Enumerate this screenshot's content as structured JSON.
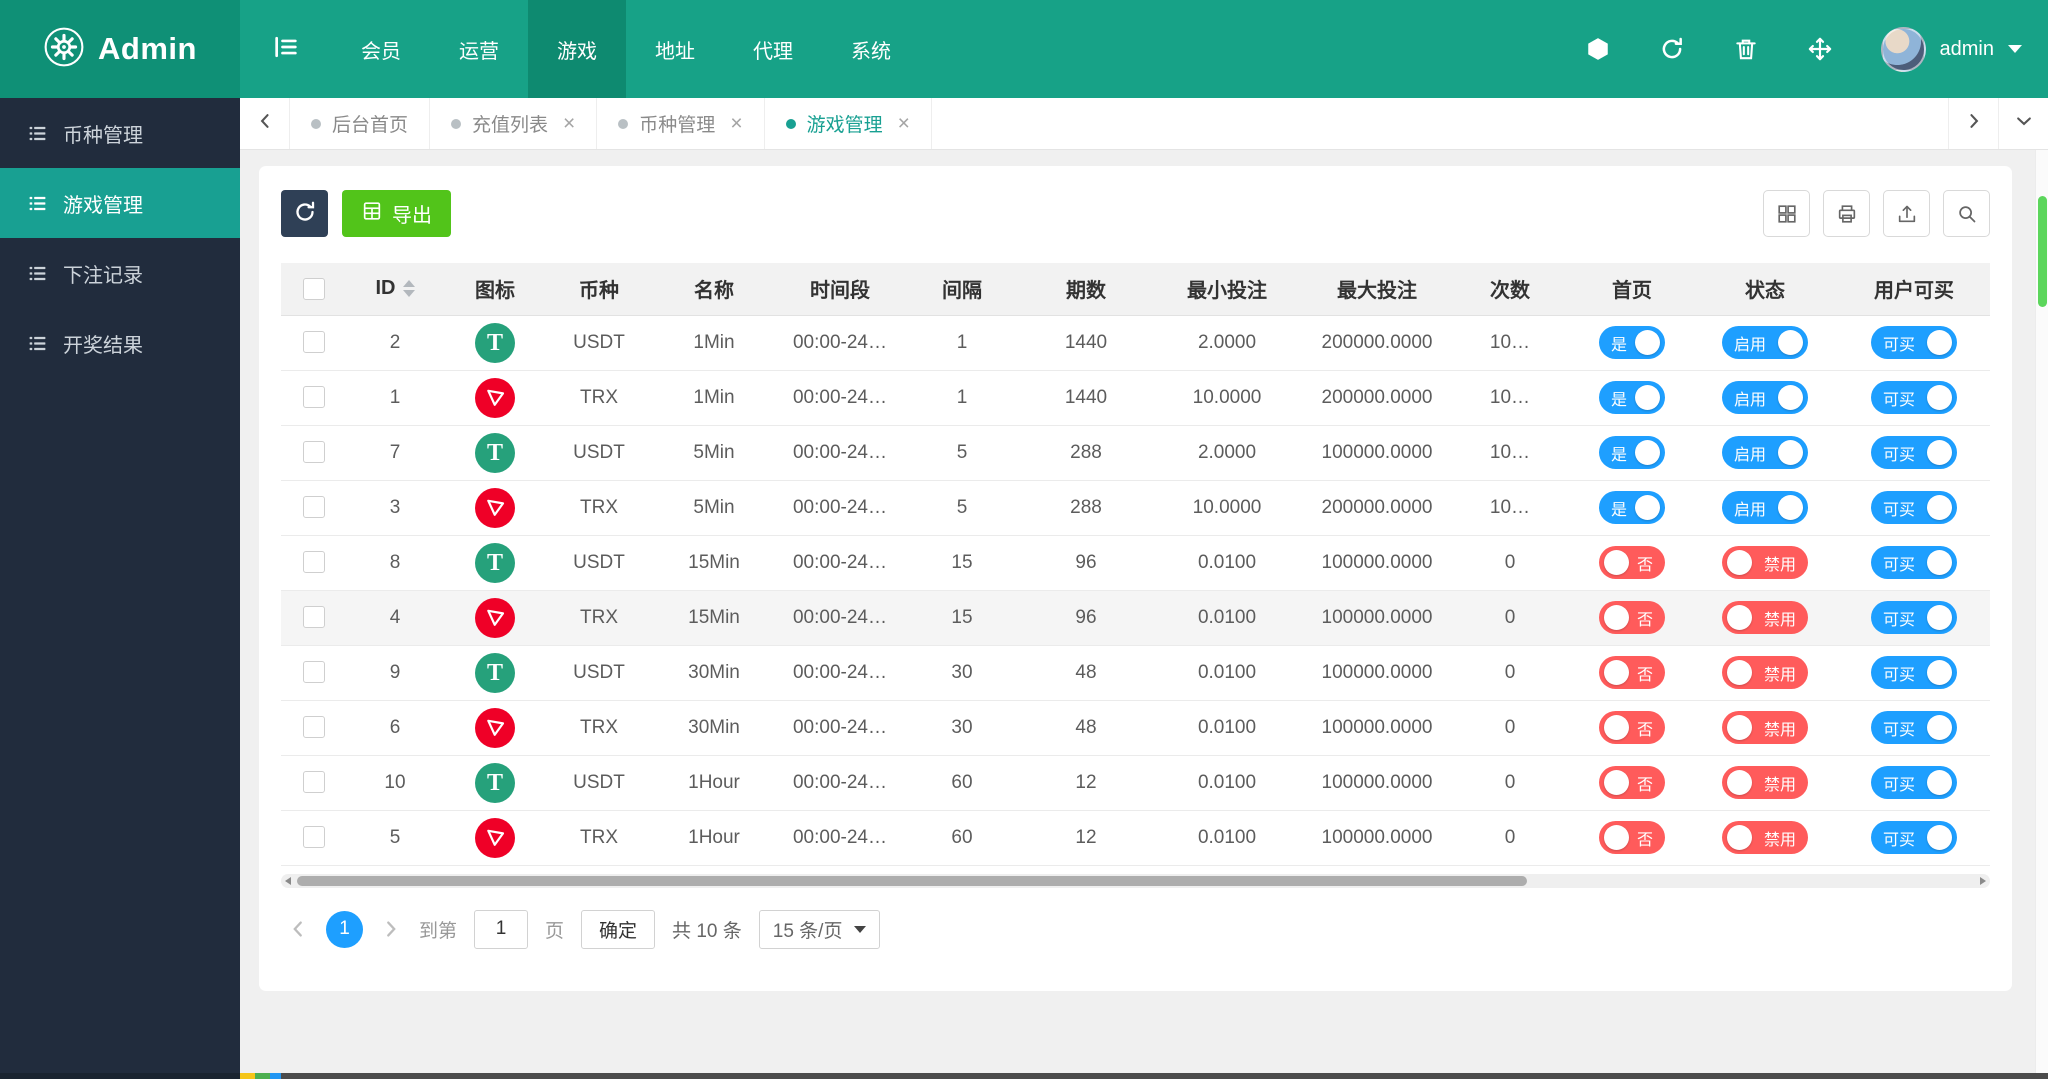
{
  "colors": {
    "header_teal": "#17A287",
    "logo_teal": "#0F9076",
    "active_menu_teal": "#0E8A70",
    "sidebar_bg": "#212C3D",
    "accent_teal": "#18A092",
    "toggle_on_blue": "#1E9FFF",
    "toggle_off_red": "#FF5B5B",
    "export_green": "#52C41A",
    "dark_button": "#2F4056",
    "usdt_green": "#26A17B",
    "trx_red": "#EF0027",
    "page_active_blue": "#1E9FFF",
    "vscroll_thumb_green": "#5CD65C"
  },
  "header": {
    "brand": "Admin",
    "logo_icon": "gear-icon",
    "collapse_icon": "collapse-sidebar-icon",
    "menu": [
      {
        "label": "会员",
        "active": false
      },
      {
        "label": "运营",
        "active": false
      },
      {
        "label": "游戏",
        "active": true
      },
      {
        "label": "地址",
        "active": false
      },
      {
        "label": "代理",
        "active": false
      },
      {
        "label": "系统",
        "active": false
      }
    ],
    "action_icons": [
      "cube-icon",
      "refresh-icon",
      "trash-icon",
      "move-arrows-icon"
    ],
    "user": {
      "name": "admin"
    }
  },
  "sidebar": {
    "items": [
      {
        "label": "币种管理",
        "active": false
      },
      {
        "label": "游戏管理",
        "active": true
      },
      {
        "label": "下注记录",
        "active": false
      },
      {
        "label": "开奖结果",
        "active": false
      }
    ]
  },
  "tabs": [
    {
      "label": "后台首页",
      "closable": false,
      "active": false
    },
    {
      "label": "充值列表",
      "closable": true,
      "active": false
    },
    {
      "label": "币种管理",
      "closable": true,
      "active": false
    },
    {
      "label": "游戏管理",
      "closable": true,
      "active": true
    }
  ],
  "toolbar": {
    "refresh_icon": "refresh-icon",
    "export_label": "导出",
    "right_icons": [
      "grid-columns-icon",
      "printer-icon",
      "upload-icon",
      "search-icon"
    ]
  },
  "table": {
    "columns": [
      {
        "label": "ID",
        "sortable": true
      },
      {
        "label": "图标",
        "sortable": false
      },
      {
        "label": "币种",
        "sortable": false
      },
      {
        "label": "名称",
        "sortable": false
      },
      {
        "label": "时间段",
        "sortable": false
      },
      {
        "label": "间隔",
        "sortable": false
      },
      {
        "label": "期数",
        "sortable": false
      },
      {
        "label": "最小投注",
        "sortable": false
      },
      {
        "label": "最大投注",
        "sortable": false
      },
      {
        "label": "次数",
        "sortable": false
      },
      {
        "label": "首页",
        "sortable": false
      },
      {
        "label": "状态",
        "sortable": false
      },
      {
        "label": "用户可买",
        "sortable": false
      }
    ],
    "switch_labels": {
      "yes": "是",
      "no": "否",
      "enabled": "启用",
      "disabled": "禁用",
      "buyable": "可买"
    },
    "rows": [
      {
        "id": "2",
        "coin": "USDT",
        "icon": "usdt-coin-icon",
        "name": "1Min",
        "period": "00:00-24…",
        "interval": "1",
        "periods": "1440",
        "min_bet": "2.0000",
        "max_bet": "200000.0000",
        "times": "10…",
        "home": true,
        "status": true,
        "buyable": true,
        "hover": false
      },
      {
        "id": "1",
        "coin": "TRX",
        "icon": "trx-coin-icon",
        "name": "1Min",
        "period": "00:00-24…",
        "interval": "1",
        "periods": "1440",
        "min_bet": "10.0000",
        "max_bet": "200000.0000",
        "times": "10…",
        "home": true,
        "status": true,
        "buyable": true,
        "hover": false
      },
      {
        "id": "7",
        "coin": "USDT",
        "icon": "usdt-coin-icon",
        "name": "5Min",
        "period": "00:00-24…",
        "interval": "5",
        "periods": "288",
        "min_bet": "2.0000",
        "max_bet": "100000.0000",
        "times": "10…",
        "home": true,
        "status": true,
        "buyable": true,
        "hover": false
      },
      {
        "id": "3",
        "coin": "TRX",
        "icon": "trx-coin-icon",
        "name": "5Min",
        "period": "00:00-24…",
        "interval": "5",
        "periods": "288",
        "min_bet": "10.0000",
        "max_bet": "200000.0000",
        "times": "10…",
        "home": true,
        "status": true,
        "buyable": true,
        "hover": false
      },
      {
        "id": "8",
        "coin": "USDT",
        "icon": "usdt-coin-icon",
        "name": "15Min",
        "period": "00:00-24…",
        "interval": "15",
        "periods": "96",
        "min_bet": "0.0100",
        "max_bet": "100000.0000",
        "times": "0",
        "home": false,
        "status": false,
        "buyable": true,
        "hover": false
      },
      {
        "id": "4",
        "coin": "TRX",
        "icon": "trx-coin-icon",
        "name": "15Min",
        "period": "00:00-24…",
        "interval": "15",
        "periods": "96",
        "min_bet": "0.0100",
        "max_bet": "100000.0000",
        "times": "0",
        "home": false,
        "status": false,
        "buyable": true,
        "hover": true
      },
      {
        "id": "9",
        "coin": "USDT",
        "icon": "usdt-coin-icon",
        "name": "30Min",
        "period": "00:00-24…",
        "interval": "30",
        "periods": "48",
        "min_bet": "0.0100",
        "max_bet": "100000.0000",
        "times": "0",
        "home": false,
        "status": false,
        "buyable": true,
        "hover": false
      },
      {
        "id": "6",
        "coin": "TRX",
        "icon": "trx-coin-icon",
        "name": "30Min",
        "period": "00:00-24…",
        "interval": "30",
        "periods": "48",
        "min_bet": "0.0100",
        "max_bet": "100000.0000",
        "times": "0",
        "home": false,
        "status": false,
        "buyable": true,
        "hover": false
      },
      {
        "id": "10",
        "coin": "USDT",
        "icon": "usdt-coin-icon",
        "name": "1Hour",
        "period": "00:00-24…",
        "interval": "60",
        "periods": "12",
        "min_bet": "0.0100",
        "max_bet": "100000.0000",
        "times": "0",
        "home": false,
        "status": false,
        "buyable": true,
        "hover": false
      },
      {
        "id": "5",
        "coin": "TRX",
        "icon": "trx-coin-icon",
        "name": "1Hour",
        "period": "00:00-24…",
        "interval": "60",
        "periods": "12",
        "min_bet": "0.0100",
        "max_bet": "100000.0000",
        "times": "0",
        "home": false,
        "status": false,
        "buyable": true,
        "hover": false
      }
    ]
  },
  "pagination": {
    "current_page": "1",
    "goto_label": "到第",
    "goto_value": "1",
    "page_unit": "页",
    "confirm_label": "确定",
    "total_label": "共 10 条",
    "page_size": "15 条/页"
  }
}
